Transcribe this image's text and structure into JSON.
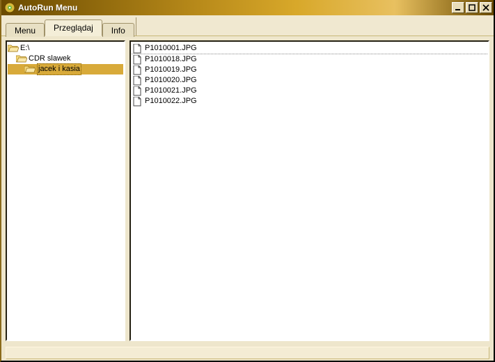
{
  "window": {
    "title": "AutoRun Menu"
  },
  "tabs": [
    {
      "label": "Menu",
      "active": false
    },
    {
      "label": "Przeglądaj",
      "active": true
    },
    {
      "label": "Info",
      "active": false
    }
  ],
  "tree": [
    {
      "label": "E:\\",
      "depth": 0,
      "open": true,
      "selected": false
    },
    {
      "label": "CDR slawek",
      "depth": 1,
      "open": true,
      "selected": false
    },
    {
      "label": "jacek i kasia",
      "depth": 2,
      "open": true,
      "selected": true
    }
  ],
  "files": [
    {
      "name": "P1010001.JPG"
    },
    {
      "name": "P1010018.JPG"
    },
    {
      "name": "P1010019.JPG"
    },
    {
      "name": "P1010020.JPG"
    },
    {
      "name": "P1010021.JPG"
    },
    {
      "name": "P1010022.JPG"
    }
  ],
  "statusbar": {
    "text": ""
  }
}
